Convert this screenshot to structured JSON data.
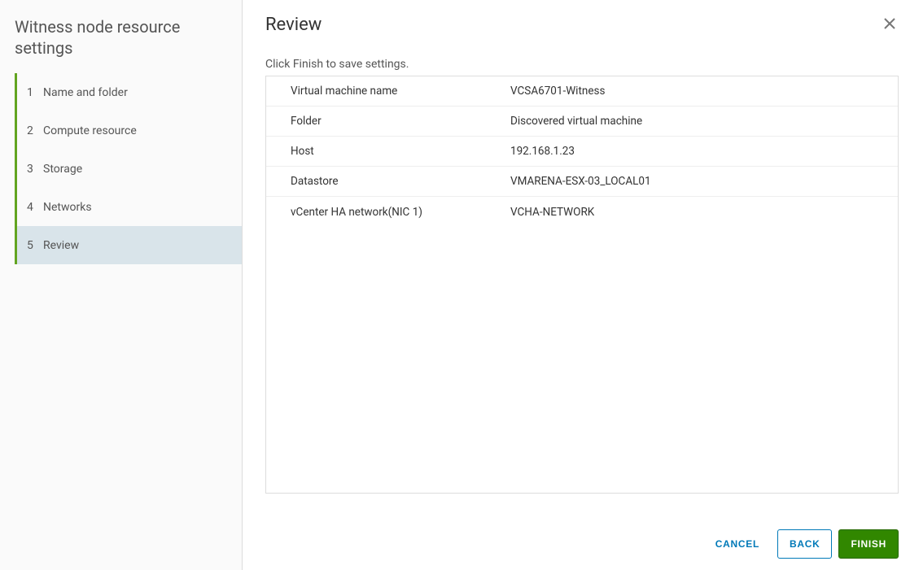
{
  "sidebar": {
    "title": "Witness node resource settings",
    "steps": [
      {
        "num": "1",
        "label": "Name and folder"
      },
      {
        "num": "2",
        "label": "Compute resource"
      },
      {
        "num": "3",
        "label": "Storage"
      },
      {
        "num": "4",
        "label": "Networks"
      },
      {
        "num": "5",
        "label": "Review"
      }
    ]
  },
  "main": {
    "title": "Review",
    "instruction": "Click Finish to save settings.",
    "rows": [
      {
        "label": "Virtual machine name",
        "value": "VCSA6701-Witness"
      },
      {
        "label": "Folder",
        "value": "Discovered virtual machine"
      },
      {
        "label": "Host",
        "value": "192.168.1.23"
      },
      {
        "label": "Datastore",
        "value": "VMARENA-ESX-03_LOCAL01"
      },
      {
        "label": "vCenter HA network(NIC 1)",
        "value": "VCHA-NETWORK"
      }
    ]
  },
  "footer": {
    "cancel": "CANCEL",
    "back": "BACK",
    "finish": "FINISH"
  }
}
